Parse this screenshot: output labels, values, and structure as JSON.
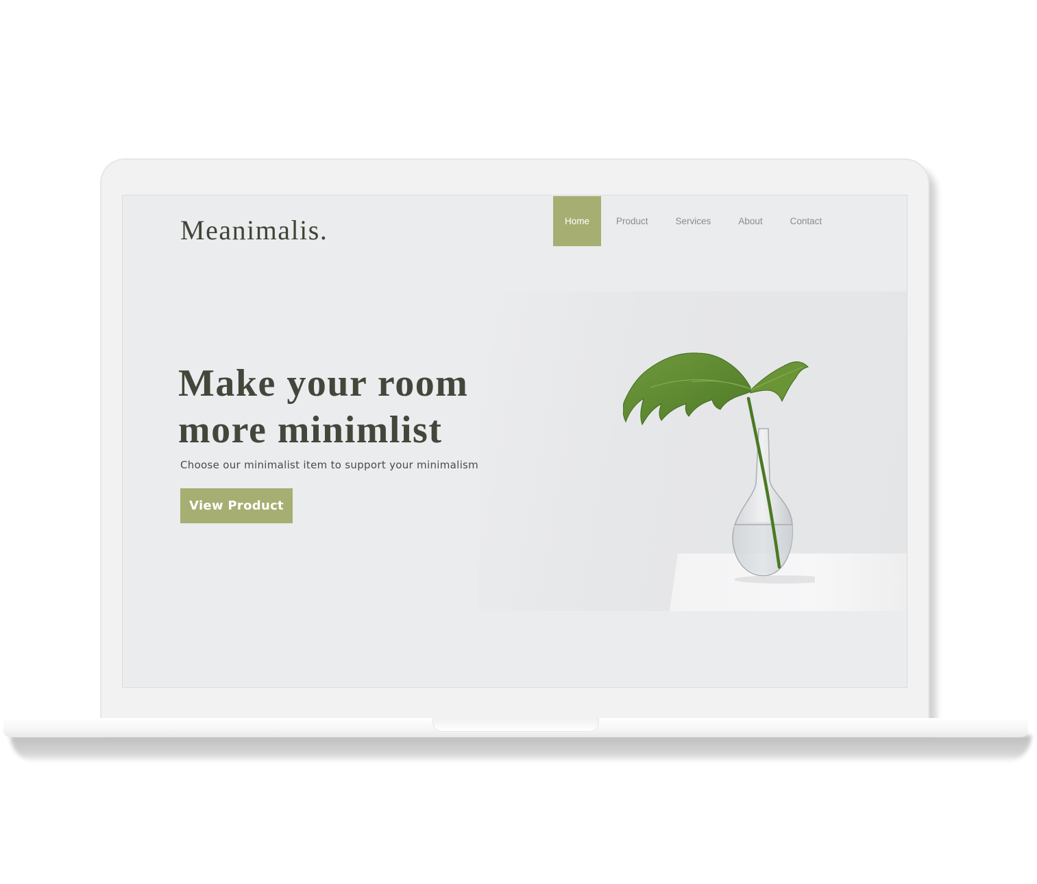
{
  "site": {
    "logo": "Meanimalis."
  },
  "nav": {
    "items": [
      {
        "label": "Home",
        "active": true
      },
      {
        "label": "Product",
        "active": false
      },
      {
        "label": "Services",
        "active": false
      },
      {
        "label": "About",
        "active": false
      },
      {
        "label": "Contact",
        "active": false
      }
    ]
  },
  "hero": {
    "headline_line1": "Make your room",
    "headline_line2": "more minimlist",
    "subtext": "Choose our minimalist item to support your minimalism",
    "cta_label": "View Product"
  },
  "colors": {
    "accent": "#a6ae72",
    "heading": "#43473b",
    "screen_background": "#ebecee",
    "nav_text": "#8b8b8b"
  },
  "icons": {
    "hero_image": "monstera-leaf-in-glass-vase"
  }
}
